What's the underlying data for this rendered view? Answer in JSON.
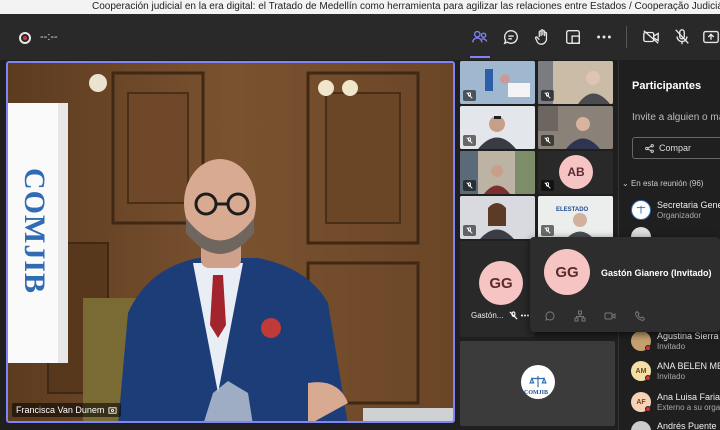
{
  "window": {
    "title": "Cooperación judicial en la era digital: el Tratado de Medellín como herramienta para agilizar las relaciones entre Estados / Cooperação Judiciária na era digital"
  },
  "toolbar": {
    "recording_time": "--:--",
    "icons": [
      "people-icon",
      "chat-icon",
      "raise-hand-icon",
      "breakout-icon",
      "more-icon",
      "camera-off-icon",
      "mic-off-icon",
      "share-tray-icon"
    ]
  },
  "stage": {
    "speaker_name": "Francisca Van Dunem",
    "banner_text": "COMJIB"
  },
  "grid": {
    "tiles": [
      {
        "kind": "video"
      },
      {
        "kind": "video"
      },
      {
        "kind": "video"
      },
      {
        "kind": "video"
      },
      {
        "kind": "video"
      },
      {
        "kind": "avatar",
        "initials": "AB"
      },
      {
        "kind": "video"
      },
      {
        "kind": "video",
        "banner": "ELESTADO"
      }
    ],
    "featured": {
      "initials": "GG",
      "name": "Gastón..."
    },
    "logo_text": "COMJIB"
  },
  "hover_card": {
    "initials": "GG",
    "name": "Gastón Gianero (Invitado)"
  },
  "participants_panel": {
    "title": "Participantes",
    "invite_placeholder": "Invite a alguien o ma",
    "share_label": "Compar",
    "section_label": "En esta reunión (96)",
    "people": [
      {
        "initials": "",
        "name": "Secretaria Gene",
        "role": "Organizador",
        "color": "#ffffff"
      },
      {
        "initials": "",
        "name": "",
        "role": "",
        "color": "#dddddd"
      },
      {
        "initials": "",
        "name": "Agustina Sierra",
        "role": "Invitado",
        "color": "#c4a070"
      },
      {
        "initials": "AM",
        "name": "ANA BELEN ME",
        "role": "Invitado",
        "color": "#f5dfa8"
      },
      {
        "initials": "AF",
        "name": "Ana Luisa Faria",
        "role": "Externo a su orga",
        "color": "#f7d3b5"
      },
      {
        "initials": "",
        "name": "Andrés Puente",
        "role": "",
        "color": "#cccccc"
      }
    ]
  }
}
